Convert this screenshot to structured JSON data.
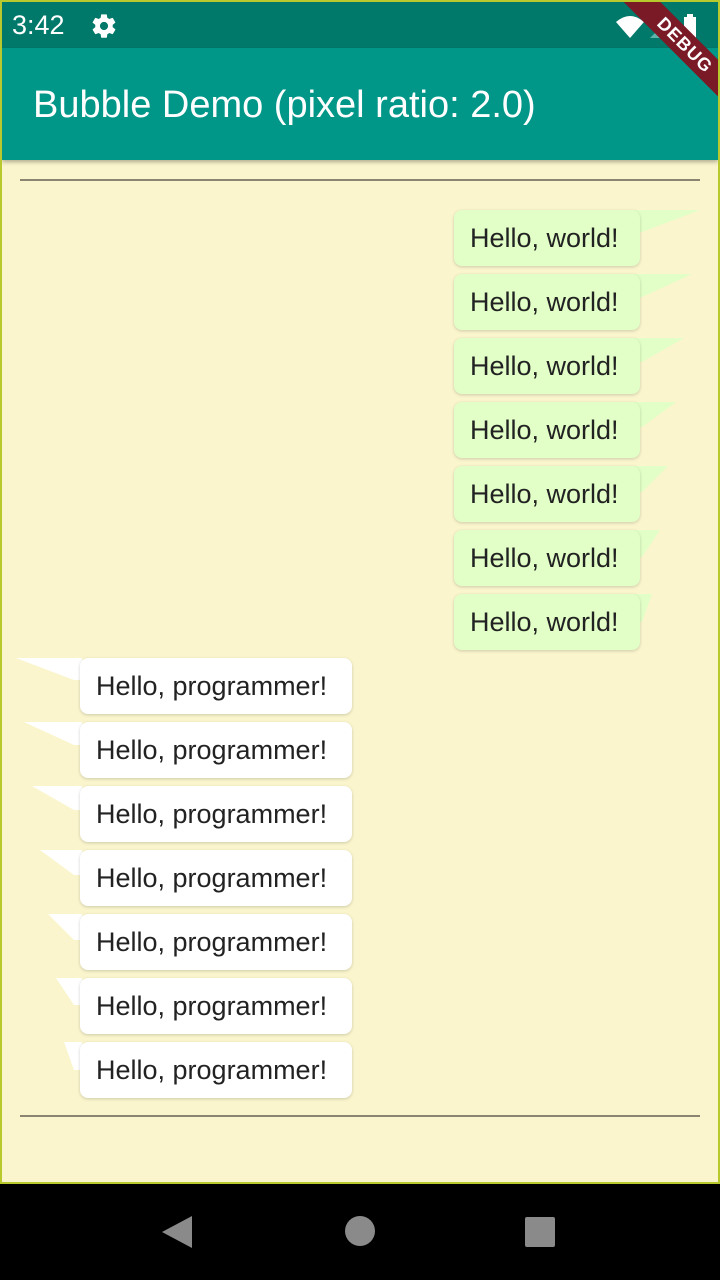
{
  "status_bar": {
    "time": "3:42",
    "icons": [
      "settings-gear-icon",
      "wifi-icon",
      "signal-icon",
      "battery-icon"
    ]
  },
  "app_bar": {
    "title": "Bubble Demo (pixel ratio: 2.0)",
    "background": "#009688",
    "debug_banner": "DEBUG"
  },
  "messages": [
    {
      "side": "right",
      "text": "Hello, world!"
    },
    {
      "side": "right",
      "text": "Hello, world!"
    },
    {
      "side": "right",
      "text": "Hello, world!"
    },
    {
      "side": "right",
      "text": "Hello, world!"
    },
    {
      "side": "right",
      "text": "Hello, world!"
    },
    {
      "side": "right",
      "text": "Hello, world!"
    },
    {
      "side": "right",
      "text": "Hello, world!"
    },
    {
      "side": "left",
      "text": "Hello, programmer!"
    },
    {
      "side": "left",
      "text": "Hello, programmer!"
    },
    {
      "side": "left",
      "text": "Hello, programmer!"
    },
    {
      "side": "left",
      "text": "Hello, programmer!"
    },
    {
      "side": "left",
      "text": "Hello, programmer!"
    },
    {
      "side": "left",
      "text": "Hello, programmer!"
    },
    {
      "side": "left",
      "text": "Hello, programmer!"
    }
  ],
  "colors": {
    "page_background": "#faf5cc",
    "outgoing_bubble": "#e1ffc7",
    "incoming_bubble": "#ffffff",
    "status_bar": "#00796b"
  },
  "nav_bar": {
    "icons": [
      "back-icon",
      "home-icon",
      "recents-icon"
    ]
  }
}
